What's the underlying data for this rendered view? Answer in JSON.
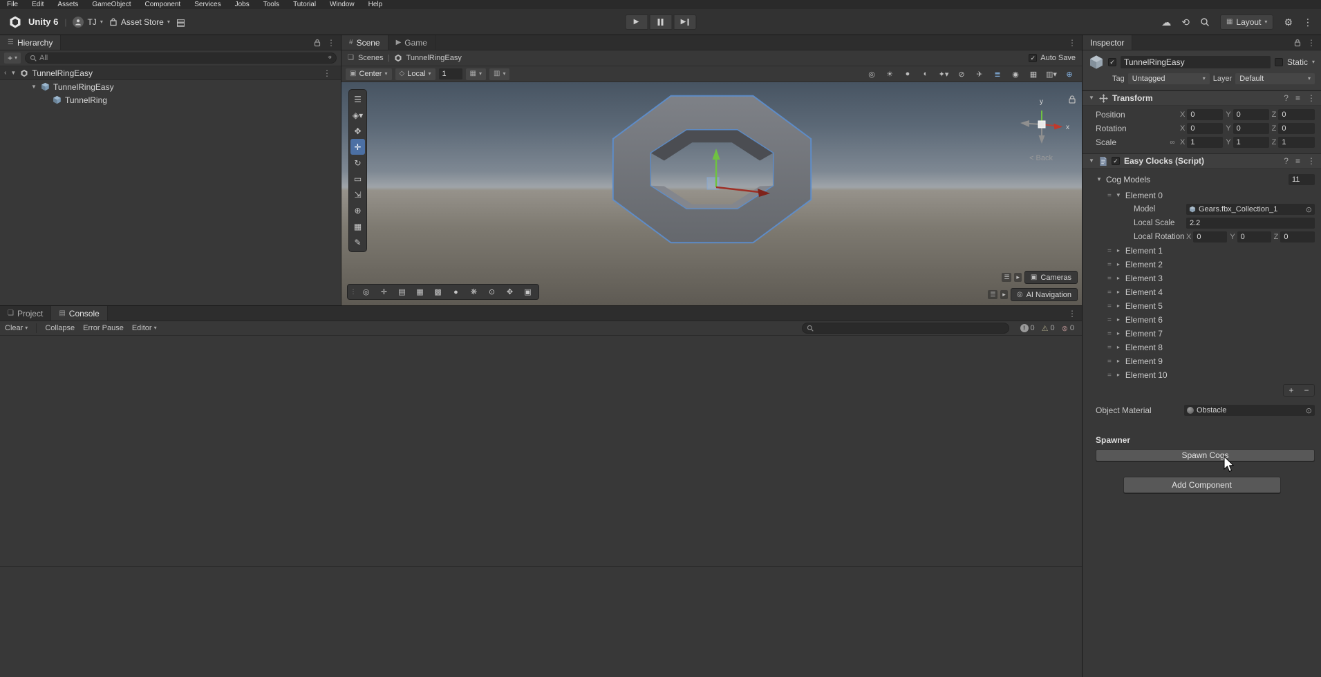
{
  "glyphs": {
    "check": "✓",
    "caret": "▾",
    "fold_open": "▼",
    "fold_closed": "▸",
    "more": "⋮",
    "handle": "☰",
    "drag": "=",
    "plus": "+",
    "minus": "−",
    "separator": "|",
    "help": "?",
    "preset": "≡",
    "picker": "⊙",
    "link": "∞",
    "collapse_left": "‹",
    "target": "⌖"
  },
  "colors": {
    "selection_outline_blue": "#5c8fd0",
    "active_tool_blue": "#4c70a4",
    "axis_x_red": "#9e2f25",
    "axis_y_green": "#6fc242"
  },
  "menu_bar": {
    "items": [
      {
        "name": "menu-file",
        "label": "File"
      },
      {
        "name": "menu-edit",
        "label": "Edit"
      },
      {
        "name": "menu-assets",
        "label": "Assets"
      },
      {
        "name": "menu-gameobject",
        "label": "GameObject"
      },
      {
        "name": "menu-component",
        "label": "Component"
      },
      {
        "name": "menu-services",
        "label": "Services"
      },
      {
        "name": "menu-jobs",
        "label": "Jobs"
      },
      {
        "name": "menu-tools",
        "label": "Tools"
      },
      {
        "name": "menu-tutorial",
        "label": "Tutorial"
      },
      {
        "name": "menu-window",
        "label": "Window"
      },
      {
        "name": "menu-help",
        "label": "Help"
      }
    ]
  },
  "toolbar": {
    "product": "Unity 6",
    "account_label": "TJ",
    "asset_store_label": "Asset Store",
    "layout_label": "Layout",
    "icons": {
      "cloud": "☁",
      "history": "⟲",
      "gear": "⚙",
      "tray": "▤",
      "grid": "▦"
    }
  },
  "hierarchy": {
    "tab_label": "Hierarchy",
    "search_placeholder": "All",
    "scene_row_label": "TunnelRingEasy",
    "root_item_label": "TunnelRingEasy",
    "child_item_label": "TunnelRing"
  },
  "scene_view": {
    "scene_tab": "Scene",
    "game_tab": "Game",
    "scene_tab_icon": "#",
    "game_tab_icon": "▶",
    "breadcrumb_scenes_icon": "❏",
    "breadcrumb_scenes": "Scenes",
    "breadcrumb_current": "TunnelRingEasy",
    "auto_save_label": "Auto Save",
    "pivot_icon": "▣",
    "pivot_label": "Center",
    "rotation_icon": "◇",
    "rotation_label": "Local",
    "grid_value": "1",
    "grid_icon_a": "▦",
    "grid_icon_b": "▥",
    "toggles": [
      {
        "name": "scene-camera-toggle",
        "glyph": "◎"
      },
      {
        "name": "lighting-toggle",
        "glyph": "☀"
      },
      {
        "name": "audio-toggle",
        "glyph": "●"
      },
      {
        "name": "effects-toggle",
        "glyph": "◐"
      },
      {
        "name": "effects-dropdown",
        "glyph": "✦▾"
      },
      {
        "name": "hidden-objects-toggle",
        "glyph": "⊘"
      },
      {
        "name": "camera-fly-toggle",
        "glyph": "✈"
      },
      {
        "name": "layers-toggle",
        "glyph": "≣",
        "active": true
      },
      {
        "name": "visibility-toggle",
        "glyph": "◉"
      },
      {
        "name": "grid-visibility-toggle",
        "glyph": "▦"
      },
      {
        "name": "grid-dropdown",
        "glyph": "▥▾"
      },
      {
        "name": "gizmos-toggle",
        "glyph": "⊕",
        "active": true
      }
    ],
    "tool_strip": [
      {
        "name": "overlay-handle",
        "glyph": "☰",
        "handle": true
      },
      {
        "name": "view-tool-dropdown",
        "glyph": "◈▾"
      },
      {
        "name": "hand-tool",
        "glyph": "✥"
      },
      {
        "name": "move-tool",
        "glyph": "✛",
        "active": true
      },
      {
        "name": "rotate-tool",
        "glyph": "↻"
      },
      {
        "name": "rect-tool",
        "glyph": "▭"
      },
      {
        "name": "scale-tool",
        "glyph": "⇲"
      },
      {
        "name": "transform-tool",
        "glyph": "⊕"
      },
      {
        "name": "snap-settings-tool",
        "glyph": "▦"
      },
      {
        "name": "custom-editor-tool",
        "glyph": "✎"
      }
    ],
    "bottom_strip": [
      {
        "name": "strip-handle",
        "glyph": "⋮",
        "handle": true
      },
      {
        "name": "render-mode-icon",
        "glyph": "◎"
      },
      {
        "name": "gizmos-icon",
        "glyph": "✛"
      },
      {
        "name": "wireframe-icon",
        "glyph": "▤"
      },
      {
        "name": "grid-snap-icon",
        "glyph": "▦"
      },
      {
        "name": "shadows-icon",
        "glyph": "▩"
      },
      {
        "name": "skybox-icon",
        "glyph": "●"
      },
      {
        "name": "flares-icon",
        "glyph": "❋"
      },
      {
        "name": "zoom-icon",
        "glyph": "⊙"
      },
      {
        "name": "pan-icon",
        "glyph": "✥"
      },
      {
        "name": "camera-preview-icon",
        "glyph": "▣"
      }
    ],
    "cameras_icon": "▣",
    "cameras_overlay_label": "Cameras",
    "ai_icon": "◎",
    "ai_navigation_label": "AI Navigation",
    "overlay_arrow": "▸",
    "gizmo": {
      "x_label": "x",
      "y_label": "y",
      "back_label": "< Back"
    }
  },
  "inspector": {
    "tab_label": "Inspector",
    "name_value": "TunnelRingEasy",
    "static_label": "Static",
    "tag_label": "Tag",
    "tag_value": "Untagged",
    "layer_label": "Layer",
    "layer_value": "Default",
    "transform": {
      "title": "Transform",
      "rows": [
        {
          "name": "transform-position-row",
          "label": "Position",
          "link": "",
          "x_label": "X",
          "x": "0",
          "y_label": "Y",
          "y": "0",
          "z_label": "Z",
          "z": "0"
        },
        {
          "name": "transform-rotation-row",
          "label": "Rotation",
          "link": "",
          "x_label": "X",
          "x": "0",
          "y_label": "Y",
          "y": "0",
          "z_label": "Z",
          "z": "0"
        },
        {
          "name": "transform-scale-row",
          "label": "Scale",
          "link": "∞",
          "x_label": "X",
          "x": "1",
          "y_label": "Y",
          "y": "1",
          "z_label": "Z",
          "z": "1"
        }
      ]
    },
    "script": {
      "title": "Easy Clocks (Script)",
      "cog_models_label": "Cog Models",
      "cog_models_count": "11",
      "element0_label": "Element 0",
      "model_label": "Model",
      "model_value": "Gears.fbx_Collection_1",
      "local_scale_label": "Local Scale",
      "local_scale_value": "2.2",
      "local_rotation_label": "Local Rotation",
      "rot_x_label": "X",
      "rot_x": "0",
      "rot_y_label": "Y",
      "rot_y": "0",
      "rot_z_label": "Z",
      "rot_z": "0",
      "elements": [
        {
          "name": "element-1-row",
          "label": "Element 1"
        },
        {
          "name": "element-2-row",
          "label": "Element 2"
        },
        {
          "name": "element-3-row",
          "label": "Element 3"
        },
        {
          "name": "element-4-row",
          "label": "Element 4"
        },
        {
          "name": "element-5-row",
          "label": "Element 5"
        },
        {
          "name": "element-6-row",
          "label": "Element 6"
        },
        {
          "name": "element-7-row",
          "label": "Element 7"
        },
        {
          "name": "element-8-row",
          "label": "Element 8"
        },
        {
          "name": "element-9-row",
          "label": "Element 9"
        },
        {
          "name": "element-10-row",
          "label": "Element 10"
        }
      ],
      "object_material_label": "Object Material",
      "object_material_value": "Obstacle",
      "spawner_label": "Spawner",
      "spawn_cogs_button": "Spawn Cogs"
    },
    "add_component_button": "Add Component"
  },
  "console": {
    "project_tab_icon": "❏",
    "project_tab": "Project",
    "console_tab_icon": "▤",
    "console_tab": "Console",
    "clear_button": "Clear",
    "collapse_button": "Collapse",
    "error_pause_button": "Error Pause",
    "editor_button": "Editor",
    "info_icon": "!",
    "info_count": "0",
    "warning_icon": "⚠",
    "warning_count": "0",
    "error_icon": "⊗",
    "error_count": "0"
  }
}
